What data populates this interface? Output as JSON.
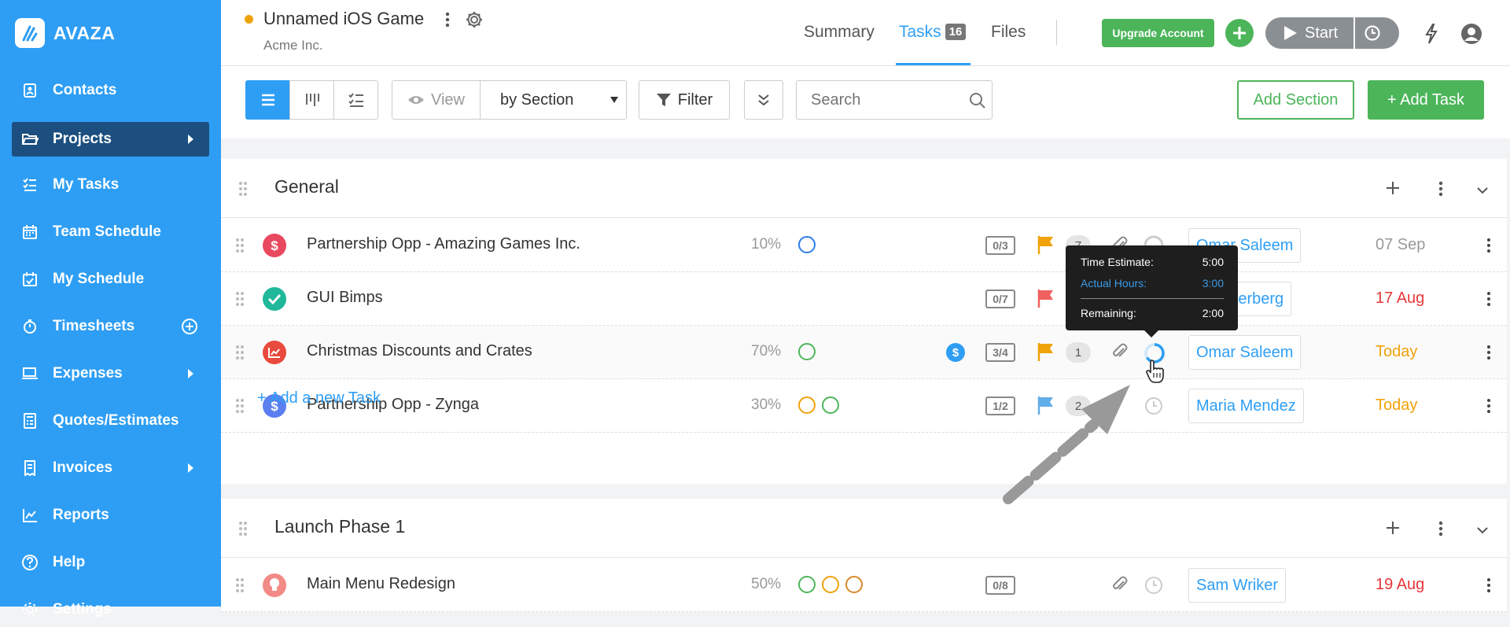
{
  "app": {
    "brand": "AVAZA"
  },
  "sidebar": {
    "items": [
      {
        "label": "Contacts",
        "icon": "contacts-icon"
      },
      {
        "label": "Projects",
        "icon": "folder-icon",
        "active": true
      },
      {
        "label": "My Tasks",
        "icon": "tasks-list-icon"
      },
      {
        "label": "Team Schedule",
        "icon": "calendar-icon"
      },
      {
        "label": "My Schedule",
        "icon": "calendar-check-icon"
      },
      {
        "label": "Timesheets",
        "icon": "stopwatch-icon"
      },
      {
        "label": "Expenses",
        "icon": "laptop-icon"
      },
      {
        "label": "Quotes/Estimates",
        "icon": "calculator-icon"
      },
      {
        "label": "Invoices",
        "icon": "receipt-icon"
      },
      {
        "label": "Reports",
        "icon": "chart-icon"
      },
      {
        "label": "Help",
        "icon": "help-icon"
      },
      {
        "label": "Settings",
        "icon": "gear-icon"
      }
    ]
  },
  "header": {
    "project_title": "Unnamed iOS Game",
    "company": "Acme Inc.",
    "tabs": [
      {
        "label": "Summary"
      },
      {
        "label": "Tasks",
        "badge": "16",
        "active": true
      },
      {
        "label": "Files"
      }
    ],
    "upgrade_label": "Upgrade Account",
    "start_label": "Start"
  },
  "toolbar": {
    "view_label": "View",
    "group_by": "by Section",
    "filter_label": "Filter",
    "search_placeholder": "Search",
    "add_section_label": "Add Section",
    "add_task_label": "+ Add Task"
  },
  "sections": [
    {
      "title": "General",
      "tasks": [
        {
          "name": "Partnership Opp - Amazing Games Inc.",
          "icon": "dollar-icon",
          "icon_color": "#e8495f",
          "percent": "10%",
          "subtasks": "0/3",
          "flag_color": "#f0a20a",
          "comments": "7",
          "assignee": "Omar Saleem",
          "due": "07 Sep",
          "due_color": "#999999"
        },
        {
          "name": "GUI Bimps",
          "icon": "check-icon",
          "icon_color": "#1fb89a",
          "percent": "",
          "subtasks": "0/7",
          "flag_color": "#f06060",
          "comments": "",
          "assignee": "Lea Herberg",
          "due": "17 Aug",
          "due_color": "#e8363a"
        },
        {
          "name": "Christmas Discounts and Crates",
          "icon": "chart-up-icon",
          "icon_color": "#e84a3d",
          "percent": "70%",
          "subtasks": "3/4",
          "flag_color": "#f0a20a",
          "comments": "1",
          "assignee": "Omar Saleem",
          "due": "Today",
          "due_color": "#f0a20a"
        },
        {
          "name": "Partnership Opp - Zynga",
          "icon": "dollar-icon",
          "icon_color": "#5b7ff0",
          "percent": "30%",
          "subtasks": "1/2",
          "flag_color": "#62aee8",
          "comments": "2",
          "assignee": "Maria Mendez",
          "due": "Today",
          "due_color": "#f0a20a"
        }
      ],
      "add_task_link": "+ Add a new Task"
    },
    {
      "title": "Launch Phase 1",
      "tasks": [
        {
          "name": "Main Menu Redesign",
          "icon": "bulb-icon",
          "icon_color": "#f28a86",
          "percent": "50%",
          "subtasks": "0/8",
          "assignee": "Sam Wriker",
          "due": "19 Aug",
          "due_color": "#e8363a"
        }
      ]
    }
  ],
  "tooltip": {
    "time_estimate_label": "Time Estimate:",
    "time_estimate_value": "5:00",
    "actual_hours_label": "Actual Hours:",
    "actual_hours_value": "3:00",
    "remaining_label": "Remaining:",
    "remaining_value": "2:00"
  }
}
